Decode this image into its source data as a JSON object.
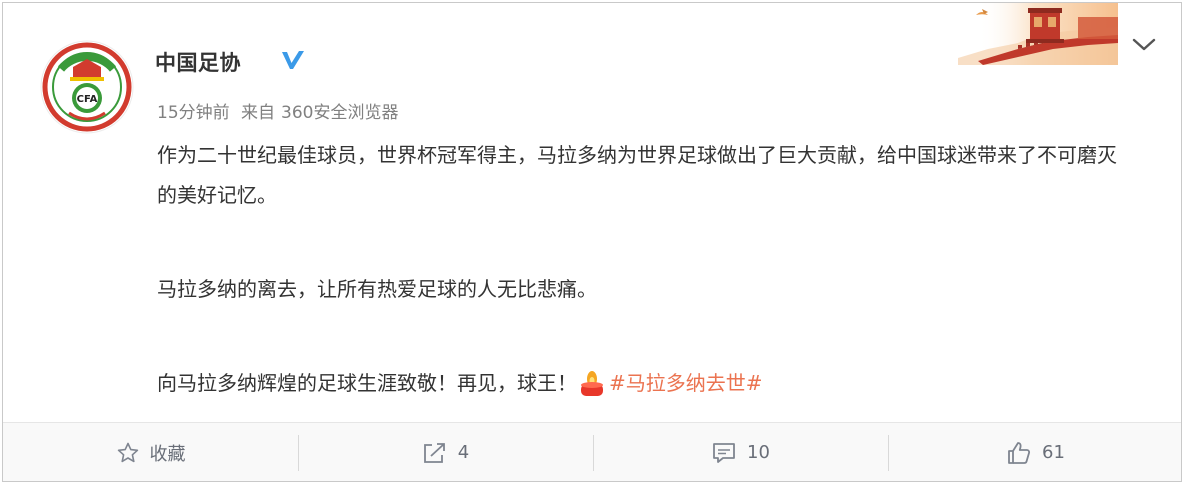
{
  "post": {
    "author": "中国足协",
    "time": "15分钟前",
    "source_prefix": "来自",
    "source": "360安全浏览器",
    "paragraphs": [
      "作为二十世纪最佳球员，世界杯冠军得主，马拉多纳为世界足球做出了巨大贡献，给中国球迷带来了不可磨灭的美好记忆。",
      "马拉多纳的离去，让所有热爱足球的人无比悲痛。"
    ],
    "last_line": "向马拉多纳辉煌的足球生涯致敬！再见，球王！",
    "hashtag": "#马拉多纳去世#",
    "avatar_text": "CFA",
    "avatar_ring_text": "中国足球协会"
  },
  "actions": {
    "favorite_label": "收藏",
    "share_count": "4",
    "comment_count": "10",
    "like_count": "61"
  },
  "icons": {
    "verified": "verified-v-icon",
    "chevron": "chevron-down-icon",
    "favorite": "star-icon",
    "share": "share-icon",
    "comment": "comment-icon",
    "like": "thumbs-up-icon",
    "candle": "candle-emoji-icon"
  },
  "colors": {
    "hashtag": "#eb7350",
    "verified": "#3b9ae8",
    "cfa_green": "#3a9a3a",
    "cfa_red": "#d23b2e"
  }
}
